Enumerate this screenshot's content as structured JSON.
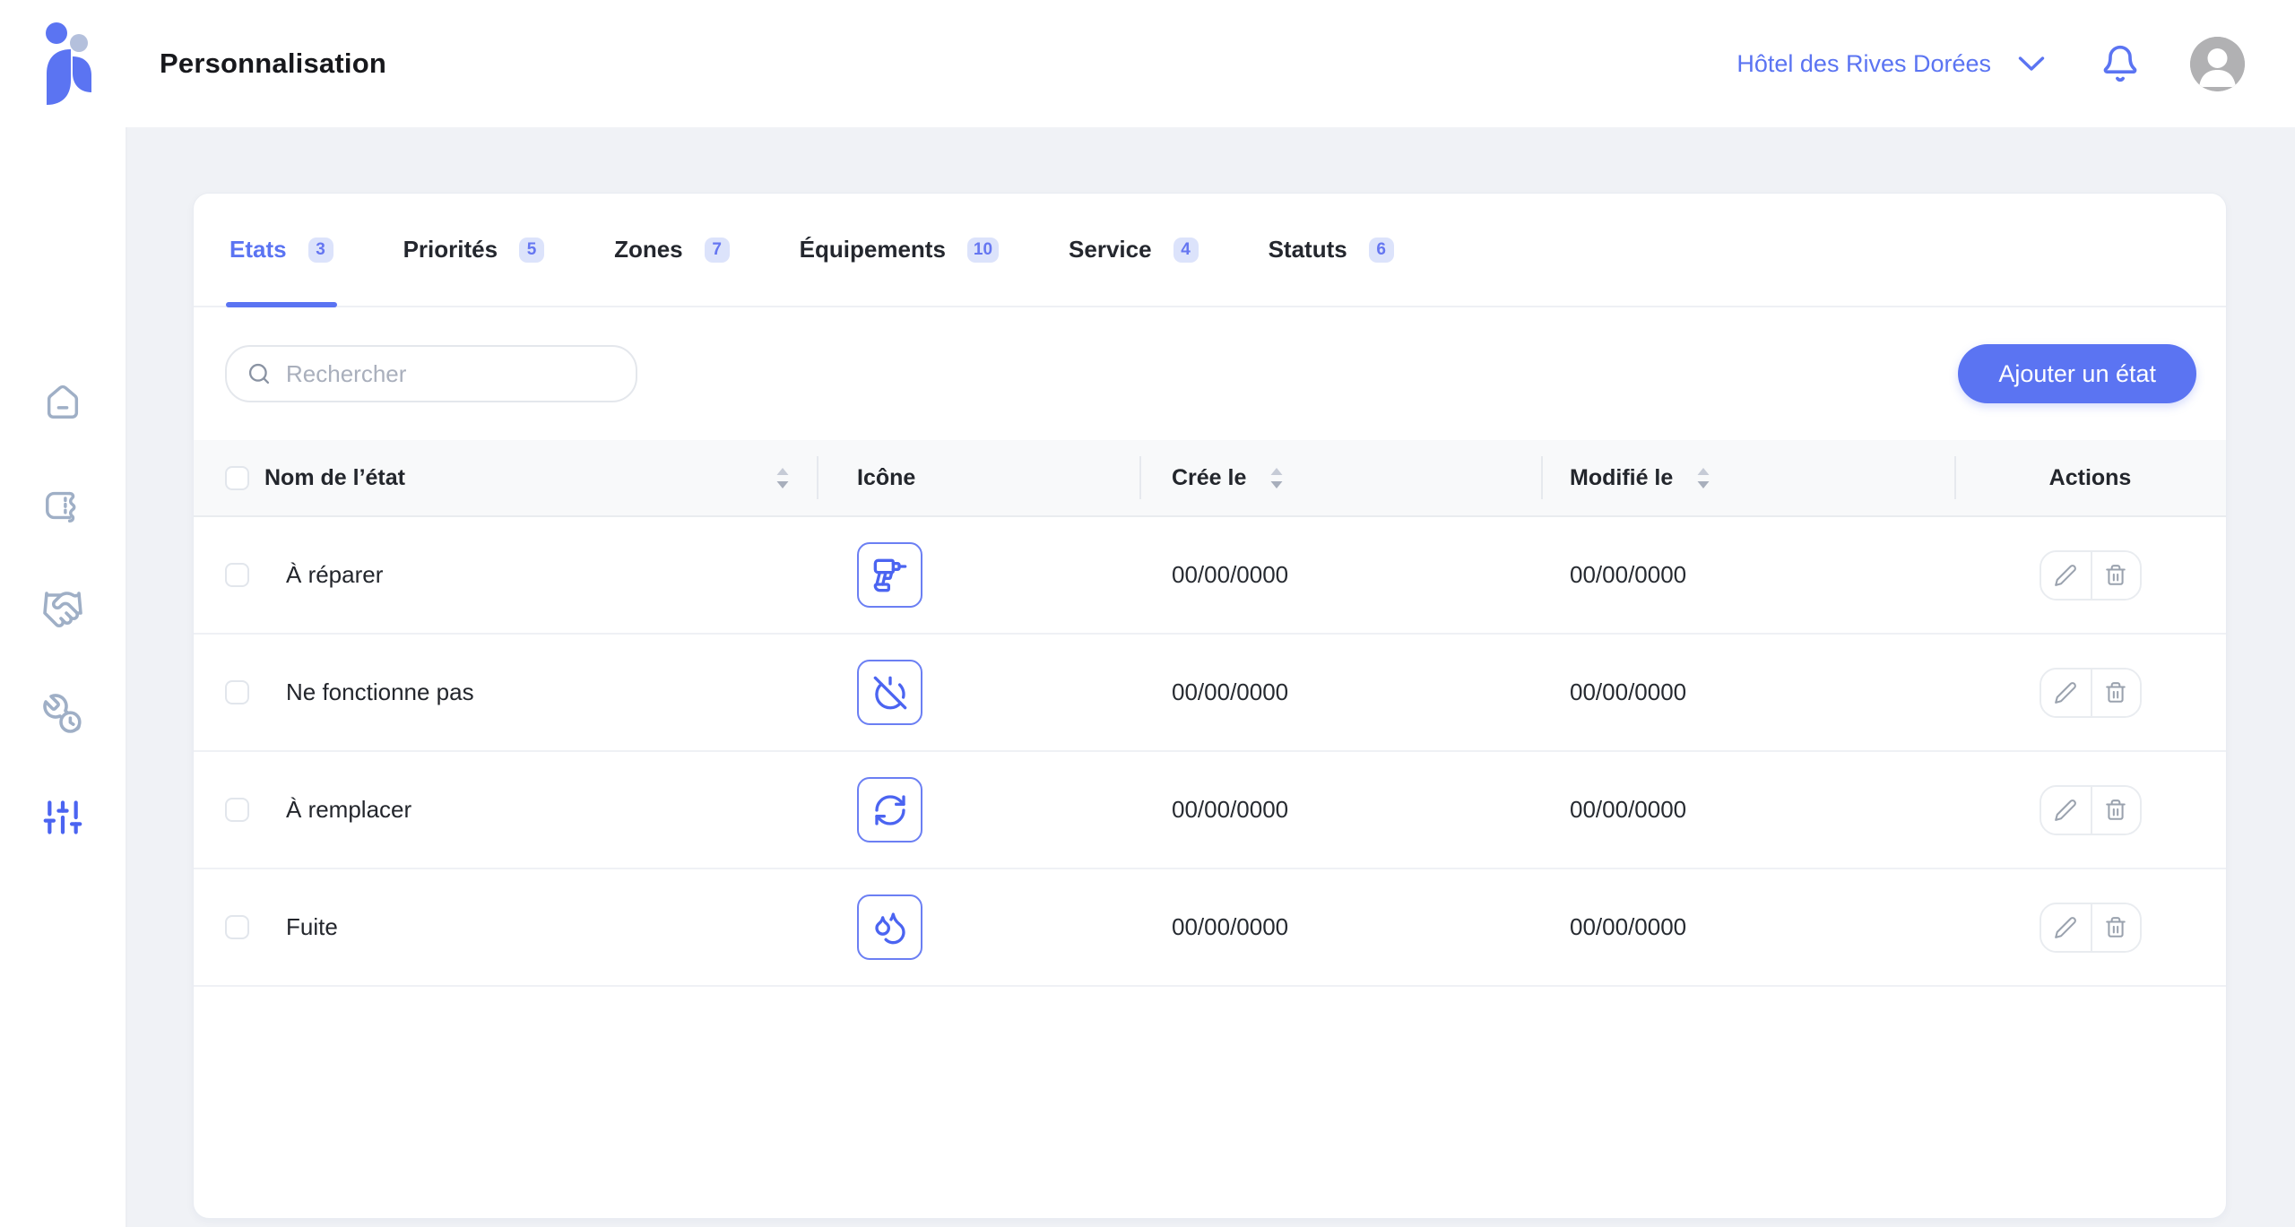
{
  "topbar": {
    "title": "Personnalisation",
    "account_label": "Hôtel des Rives Dorées"
  },
  "sidebar": {
    "items": [
      {
        "icon": "home"
      },
      {
        "icon": "ticket"
      },
      {
        "icon": "handshake"
      },
      {
        "icon": "wrench-clock"
      },
      {
        "icon": "sliders-settings",
        "active": true
      }
    ]
  },
  "tabs": [
    {
      "label": "Etats",
      "count": "3",
      "active": true
    },
    {
      "label": "Priorités",
      "count": "5",
      "active": false
    },
    {
      "label": "Zones",
      "count": "7",
      "active": false
    },
    {
      "label": "Équipements",
      "count": "10",
      "active": false
    },
    {
      "label": "Service",
      "count": "4",
      "active": false
    },
    {
      "label": "Statuts",
      "count": "6",
      "active": false
    }
  ],
  "toolbar": {
    "search_placeholder": "Rechercher",
    "add_button_label": "Ajouter un état"
  },
  "table": {
    "headers": {
      "name": "Nom de l’état",
      "icon": "Icône",
      "created": "Crée le",
      "modified": "Modifié le",
      "actions": "Actions"
    },
    "rows": [
      {
        "name": "À réparer",
        "icon": "drill",
        "created": "00/00/0000",
        "modified": "00/00/0000"
      },
      {
        "name": "Ne fonctionne pas",
        "icon": "power-off",
        "created": "00/00/0000",
        "modified": "00/00/0000"
      },
      {
        "name": "À remplacer",
        "icon": "refresh",
        "created": "00/00/0000",
        "modified": "00/00/0000"
      },
      {
        "name": "Fuite",
        "icon": "droplets",
        "created": "00/00/0000",
        "modified": "00/00/0000"
      }
    ]
  },
  "colors": {
    "accent": "#5B74F2",
    "badge_bg": "#DCE3FB",
    "page_bg": "#F0F2F6",
    "sidebar_icon": "#9FAFC6",
    "row_icon_stroke": "#4B64F1",
    "muted_icon": "#9AA2AE"
  }
}
